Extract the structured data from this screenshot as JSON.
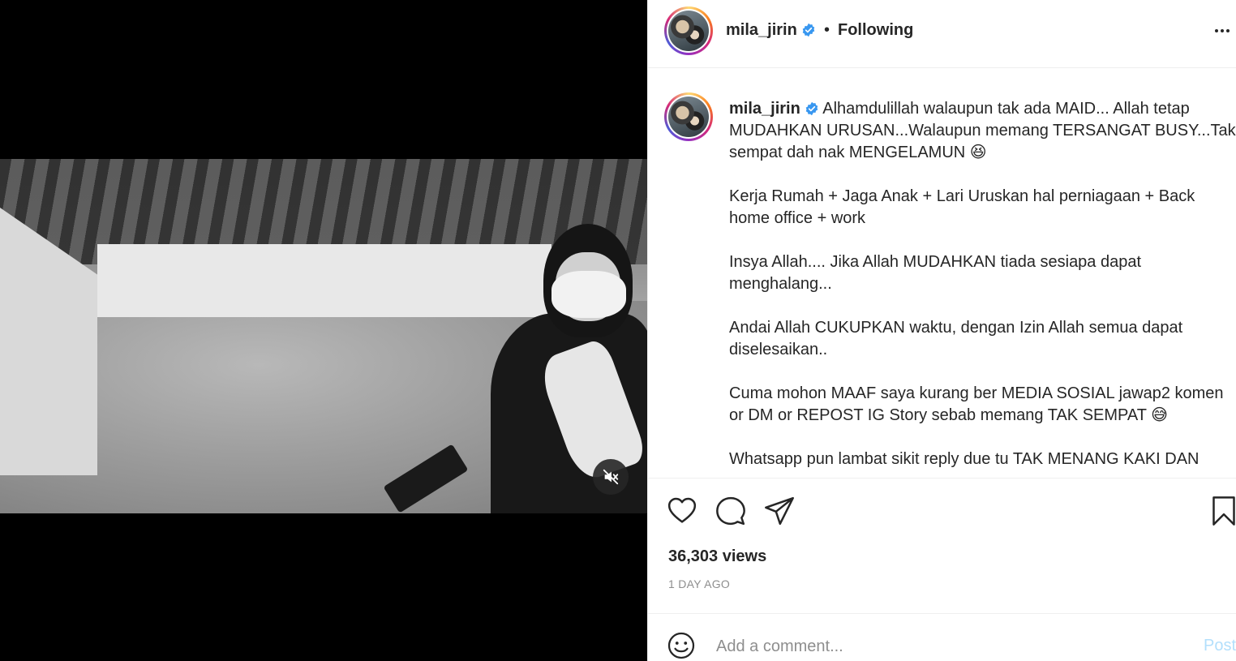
{
  "post": {
    "username": "mila_jirin",
    "separator": "•",
    "follow_status": "Following",
    "caption_paragraphs": [
      "Alhamdulillah walaupun tak ada MAID... Allah tetap MUDAHKAN URUSAN...Walaupun memang TERSANGAT BUSY...Tak sempat dah nak MENGELAMUN 😆",
      "Kerja Rumah + Jaga Anak + Lari Uruskan hal perniagaan + Back home office + work",
      "Insya Allah.... Jika Allah MUDAHKAN tiada sesiapa dapat menghalang...",
      "Andai Allah CUKUPKAN waktu, dengan Izin Allah semua dapat diselesaikan..",
      "Cuma mohon MAAF saya kurang ber MEDIA SOSIAL jawap2 komen or DM or REPOST IG Story sebab memang TAK SEMPAT 😅",
      "Whatsapp pun lambat sikit reply due tu TAK MENANG KAKI DAN"
    ],
    "views": "36,303 views",
    "time_ago": "1 DAY AGO"
  },
  "comment": {
    "placeholder": "Add a comment...",
    "post_label": "Post"
  },
  "icons": {
    "verified": "verified-badge-icon",
    "more": "more-options-icon",
    "mute": "muted-speaker-icon",
    "like": "heart-icon",
    "comment": "comment-bubble-icon",
    "share": "paper-plane-icon",
    "save": "bookmark-icon",
    "emoji": "smiley-icon"
  },
  "colors": {
    "verified_blue": "#3897f0",
    "post_button_disabled": "#b2dffc",
    "muted_text": "#8e8e8e",
    "divider": "#efefef"
  }
}
